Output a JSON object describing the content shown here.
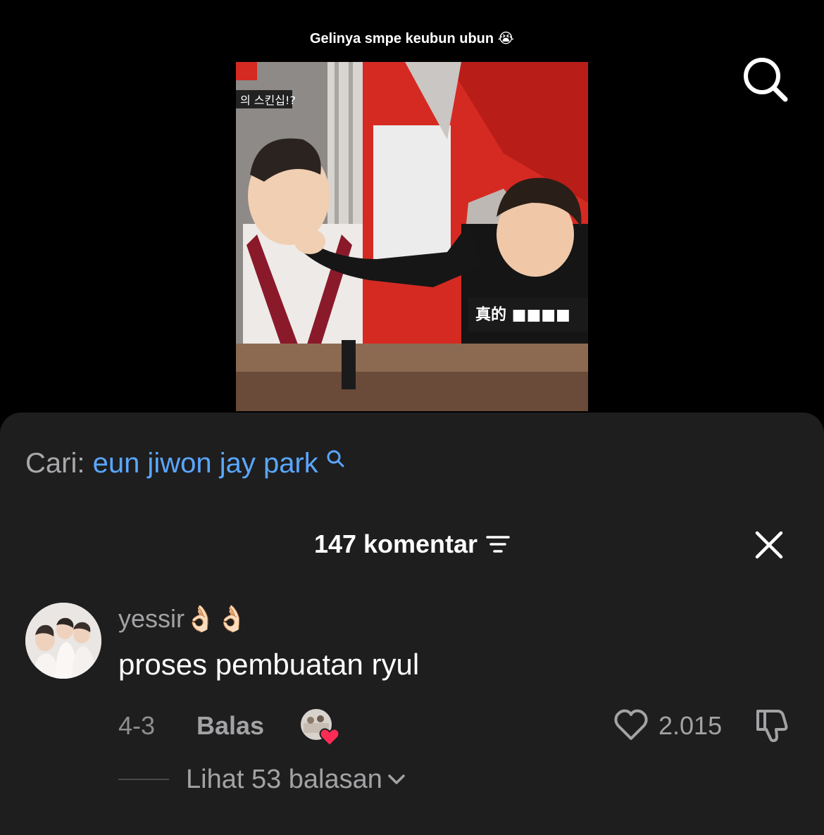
{
  "video": {
    "caption": "Gelinya smpe keubun ubun 😭",
    "overlay_text": "의 스킨십!?",
    "subtitle_text": "真的 ■■■■"
  },
  "search": {
    "label": "Cari:",
    "query": "eun jiwon jay park"
  },
  "comments_header": {
    "count_label": "147 komentar"
  },
  "comment": {
    "username": "yessir",
    "username_emoji": "👌🏻👌🏻",
    "text": "proses pembuatan ryul",
    "date": "4-3",
    "reply_label": "Balas",
    "like_count": "2.015",
    "view_replies_label": "Lihat 53 balasan"
  },
  "colors": {
    "background": "#000000",
    "sheet": "#1e1e1f",
    "link_blue": "#5aa7ff",
    "muted_text": "#a3a3a5",
    "heart_red": "#fe2c55"
  },
  "icons": [
    "search-icon",
    "filter-icon",
    "close-icon",
    "heart-icon",
    "dislike-icon",
    "chevron-down-icon"
  ]
}
